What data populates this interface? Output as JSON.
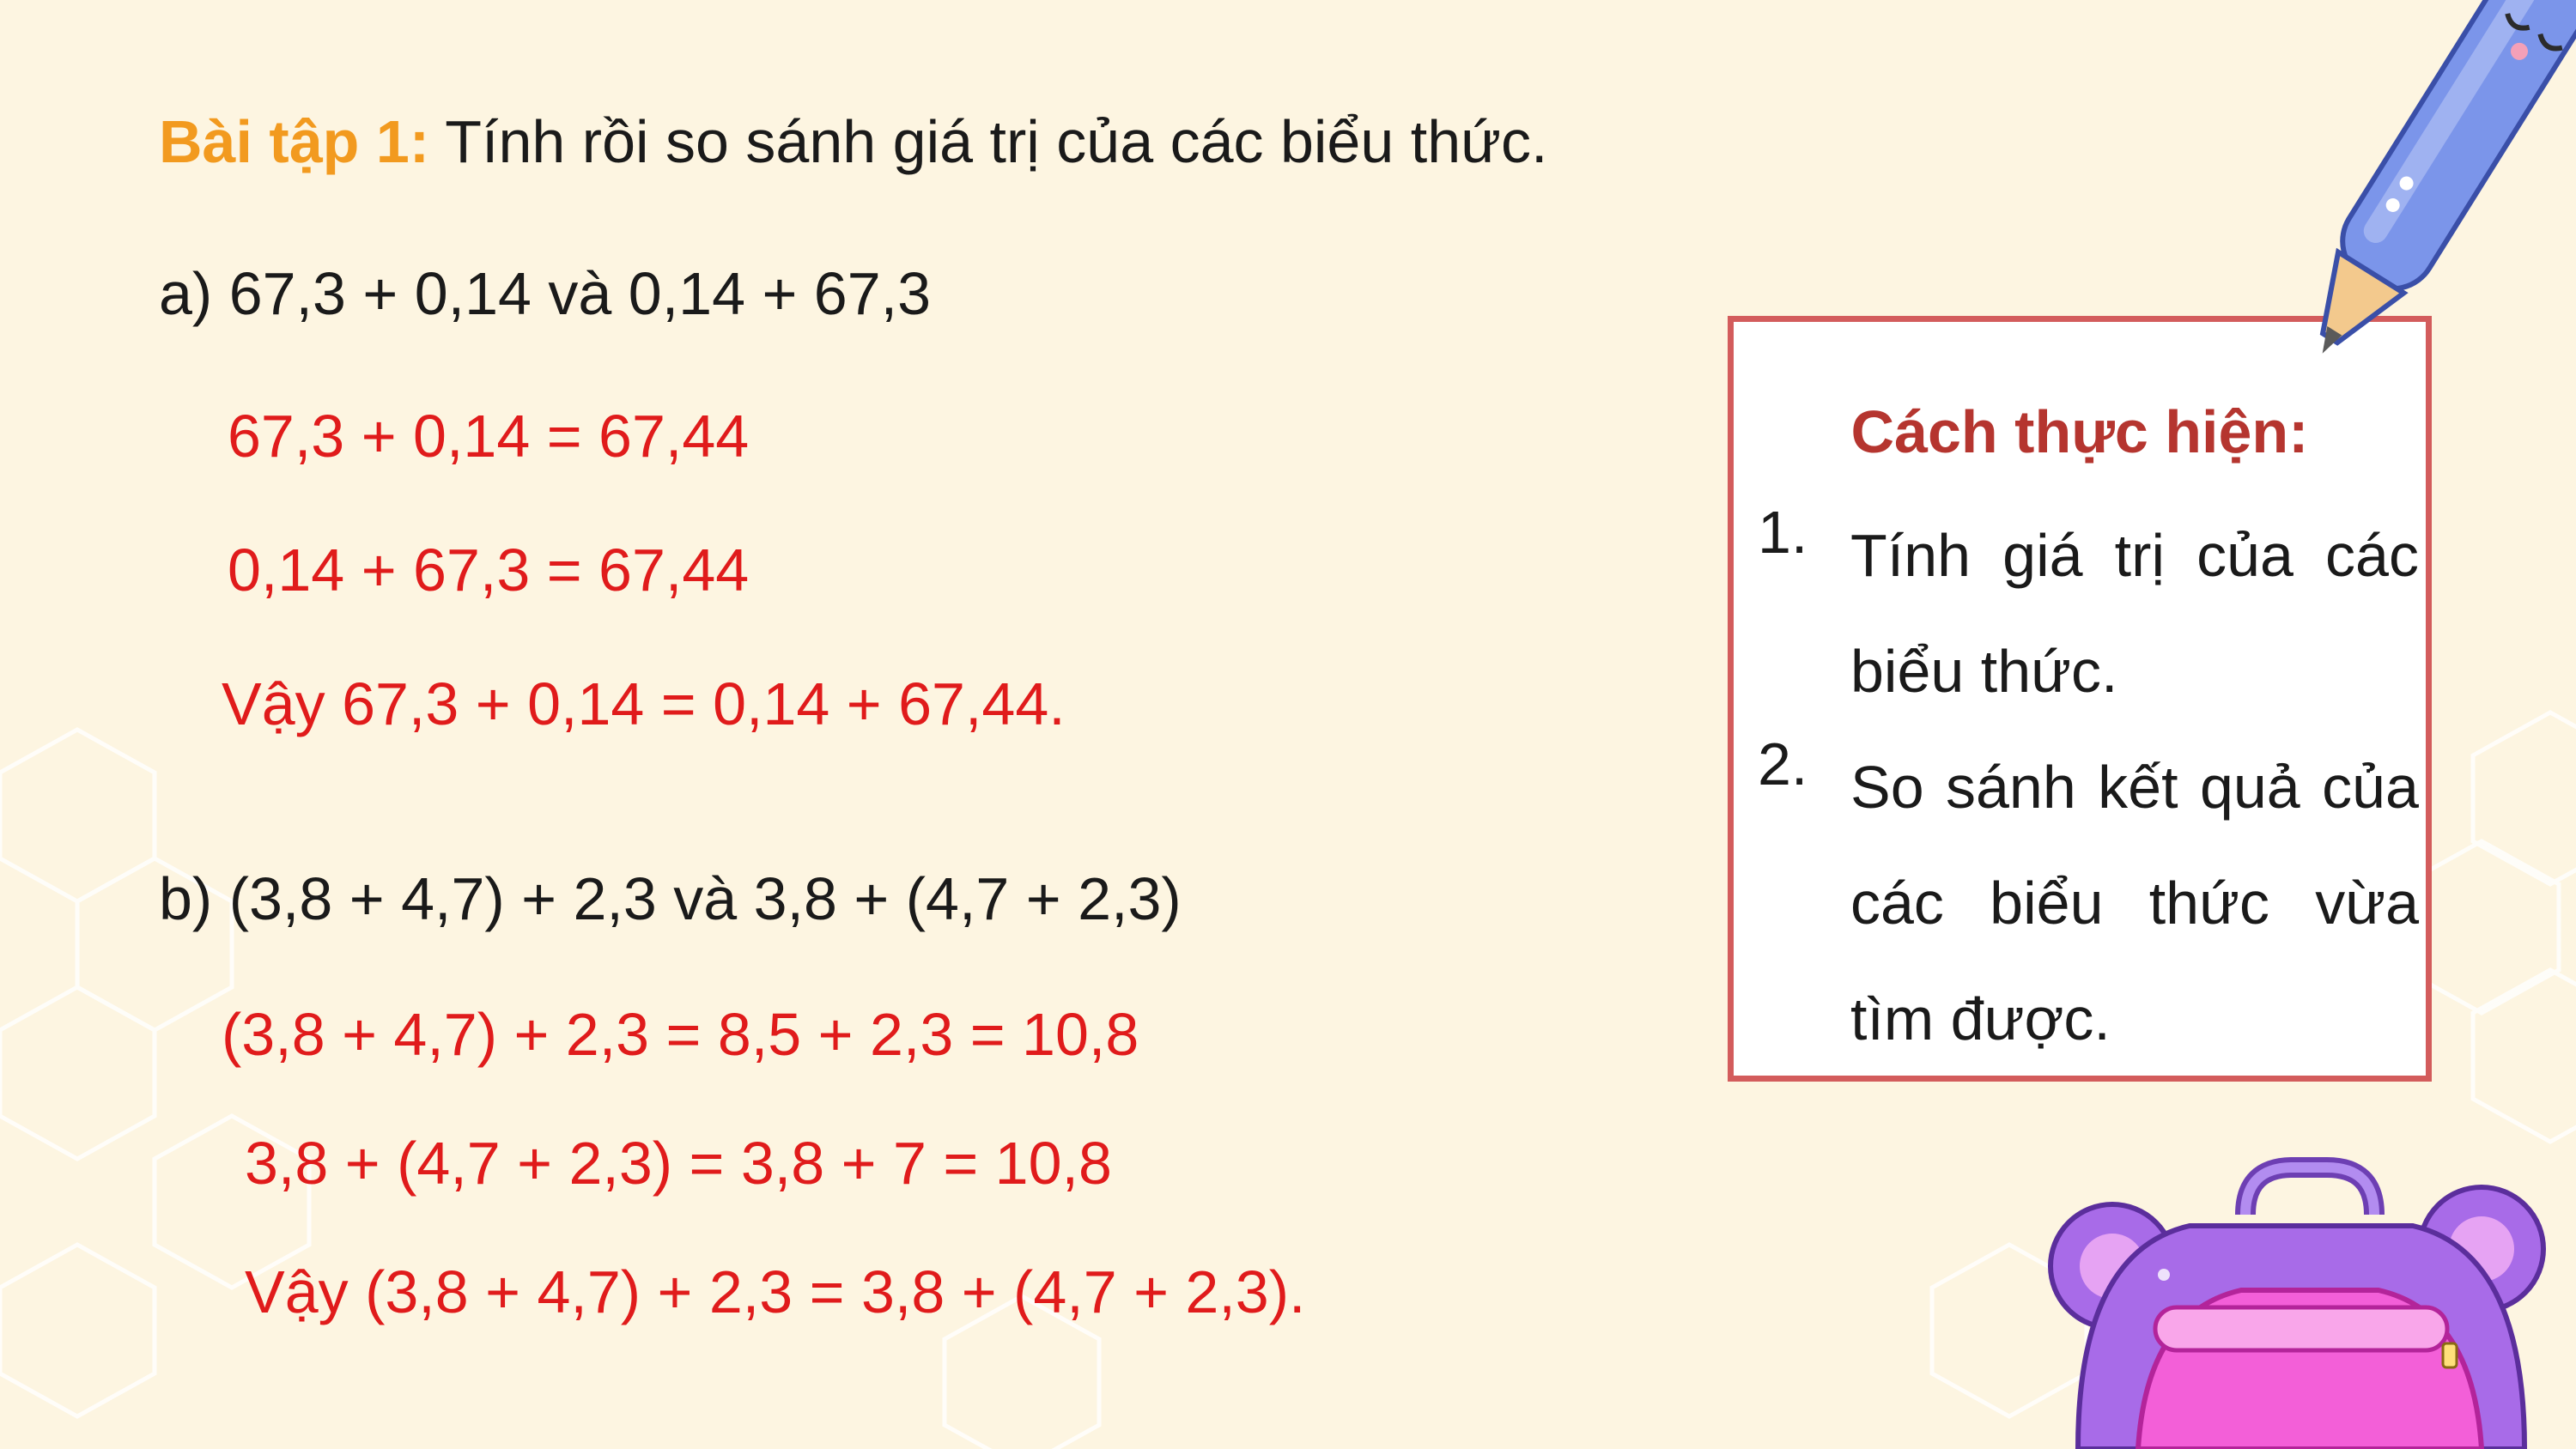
{
  "exercise": {
    "label": "Bài tập 1:",
    "instruction": " Tính rồi so sánh giá trị của các biểu thức."
  },
  "part_a": {
    "question": "a) 67,3 + 0,14 và 0,14 + 67,3",
    "lines": [
      "67,3 + 0,14 = 67,44",
      "0,14 + 67,3 = 67,44",
      "Vậy 67,3 + 0,14 = 0,14 + 67,44."
    ]
  },
  "part_b": {
    "question": "b) (3,8 + 4,7) + 2,3 và 3,8 + (4,7 + 2,3)",
    "lines": [
      "(3,8 + 4,7) + 2,3 = 8,5 + 2,3 = 10,8",
      "3,8 + (4,7 + 2,3) = 3,8 + 7 = 10,8",
      "Vậy (3,8 + 4,7) + 2,3 = 3,8 + (4,7 + 2,3)."
    ]
  },
  "method_box": {
    "title": "Cách thực hiện:",
    "steps": [
      {
        "num": "1.",
        "text": "Tính giá trị của các biểu thức."
      },
      {
        "num": "2.",
        "text": "So sánh kết quả của các biểu thức vừa tìm được."
      }
    ]
  },
  "colors": {
    "background": "#fdf5e1",
    "label_orange": "#f29a1f",
    "answer_red": "#e01b1b",
    "box_border": "#d35c5c",
    "box_title": "#b5352f"
  },
  "icons": [
    "pencil-illustration",
    "backpack-illustration"
  ]
}
